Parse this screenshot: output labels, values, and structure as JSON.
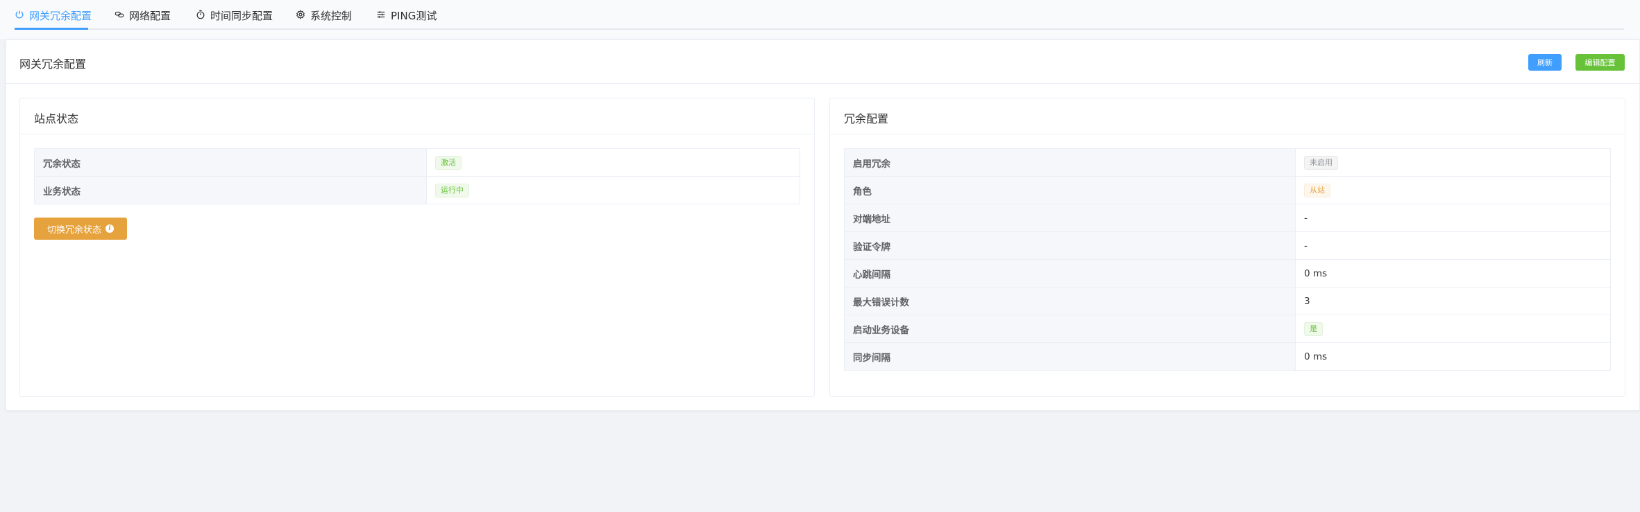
{
  "tabs": [
    {
      "label": "网关冗余配置",
      "icon": "power-icon",
      "active": true
    },
    {
      "label": "网络配置",
      "icon": "link-icon",
      "active": false
    },
    {
      "label": "时间同步配置",
      "icon": "timer-icon",
      "active": false
    },
    {
      "label": "系统控制",
      "icon": "gear-icon",
      "active": false
    },
    {
      "label": "PING测试",
      "icon": "sliders-icon",
      "active": false
    }
  ],
  "main": {
    "title": "网关冗余配置",
    "refresh_label": "刷新",
    "edit_label": "编辑配置"
  },
  "station": {
    "title": "站点状态",
    "rows": [
      {
        "label": "冗余状态",
        "value": "激活",
        "tag": "success"
      },
      {
        "label": "业务状态",
        "value": "运行中",
        "tag": "success"
      }
    ],
    "switch_label": "切换冗余状态"
  },
  "redundancy": {
    "title": "冗余配置",
    "rows": [
      {
        "label": "启用冗余",
        "value": "未启用",
        "tag": "info"
      },
      {
        "label": "角色",
        "value": "从站",
        "tag": "warning"
      },
      {
        "label": "对端地址",
        "value": "-"
      },
      {
        "label": "验证令牌",
        "value": "-"
      },
      {
        "label": "心跳间隔",
        "value": "0 ms"
      },
      {
        "label": "最大错误计数",
        "value": "3"
      },
      {
        "label": "启动业务设备",
        "value": "是",
        "tag": "success"
      },
      {
        "label": "同步间隔",
        "value": "0 ms"
      }
    ]
  },
  "colors": {
    "primary": "#409eff",
    "success": "#67c23a",
    "warning": "#e6a23c",
    "info": "#909399"
  }
}
